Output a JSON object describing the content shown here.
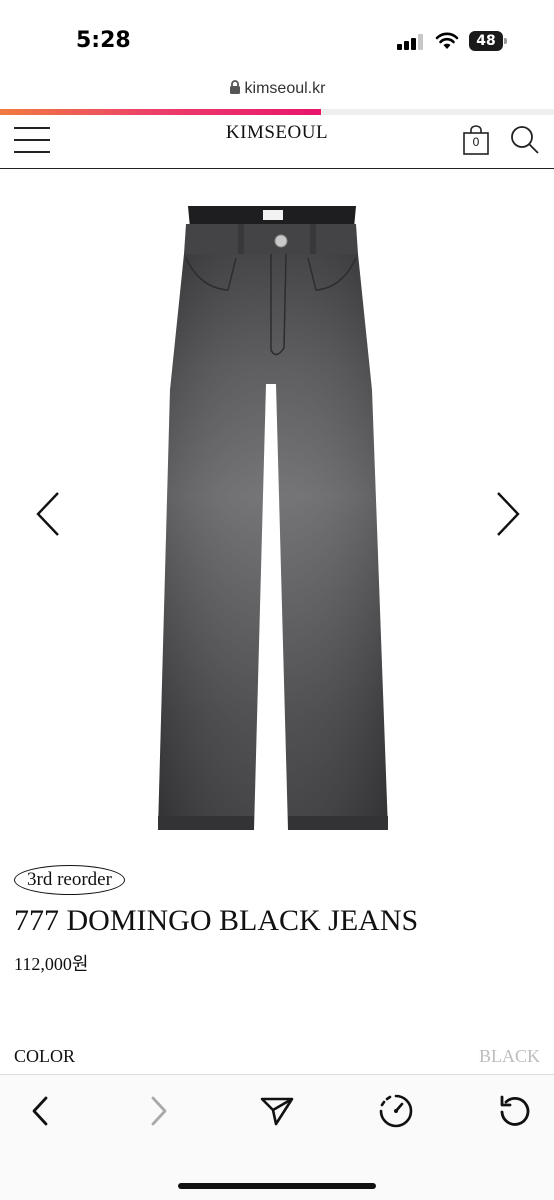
{
  "status": {
    "time": "5:28",
    "battery": "48"
  },
  "browser": {
    "url": "kimseoul.kr",
    "load_progress": 0.58
  },
  "site": {
    "logo": "KIMSEOUL",
    "cart_count": "0"
  },
  "product": {
    "badge": "3rd reorder",
    "name": "777 DOMINGO BLACK JEANS",
    "price": "112,000원",
    "color_label": "COLOR",
    "color_value": "BLACK"
  },
  "icons": {
    "menu": "hamburger-icon",
    "cart": "shopping-bag-icon",
    "search": "search-icon",
    "prev_image": "chevron-left-icon",
    "next_image": "chevron-right-icon",
    "back": "back-icon",
    "forward": "forward-icon",
    "share": "send-icon",
    "speed": "gauge-icon",
    "reload": "reload-icon"
  }
}
